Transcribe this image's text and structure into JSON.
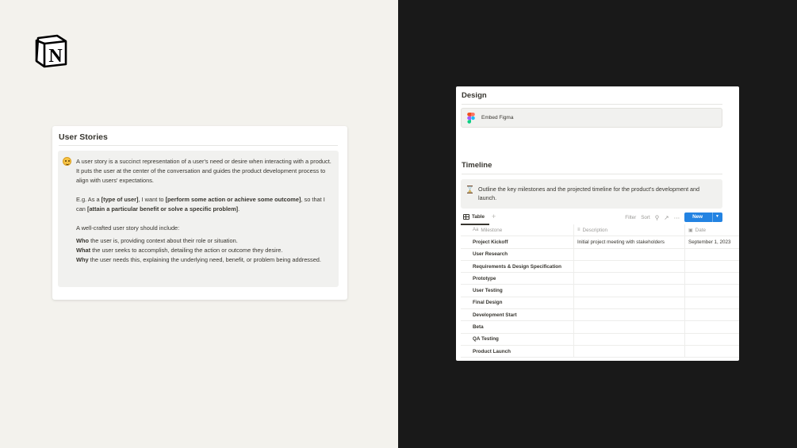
{
  "logo": {
    "icon": "notion-logo-icon",
    "letter": "N"
  },
  "user_stories": {
    "title": "User Stories",
    "emoji": "smiling-face-icon",
    "intro": "A user story is a succinct representation of a user's need or desire when interacting with a product. It puts the user at the center of the conversation and guides the product development process to align with users' expectations.",
    "example": {
      "prefix": "E.g. As a ",
      "b1": "[type of user]",
      "mid1": ", I want to ",
      "b2": "[perform some action or achieve some outcome]",
      "mid2": ", so that I can ",
      "b3": "[attain a particular benefit or solve a specific problem]",
      "suffix": "."
    },
    "include_heading": "A well-crafted user story should include:",
    "items": [
      {
        "bold": "Who",
        "text": " the user is, providing context about their role or situation."
      },
      {
        "bold": "What",
        "text": " the user seeks to accomplish, detailing the action or outcome they desire."
      },
      {
        "bold": "Why",
        "text": " the user needs this, explaining the underlying need, benefit, or problem being addressed."
      }
    ]
  },
  "design": {
    "title": "Design",
    "embed_label": "Embed Figma",
    "embed_icon": "figma-icon",
    "timeline_title": "Timeline",
    "timeline_icon": "hourglass-icon",
    "timeline_text": "Outline the key milestones and the projected timeline for the product's development and launch.",
    "toolbar": {
      "view_label": "Table",
      "add_view": "+",
      "filter": "Filter",
      "sort": "Sort",
      "new_label": "New"
    },
    "table": {
      "headers": {
        "milestone": "Milestone",
        "milestone_icon": "Aa",
        "description": "Description",
        "date": "Date"
      },
      "rows": [
        {
          "milestone": "Project Kickoff",
          "description": "Initial project meeting with stakeholders",
          "date": "September 1, 2023"
        },
        {
          "milestone": "User Research",
          "description": "",
          "date": ""
        },
        {
          "milestone": "Requirements & Design Specification",
          "description": "",
          "date": ""
        },
        {
          "milestone": "Prototype",
          "description": "",
          "date": ""
        },
        {
          "milestone": "User Testing",
          "description": "",
          "date": ""
        },
        {
          "milestone": "Final Design",
          "description": "",
          "date": ""
        },
        {
          "milestone": "Development Start",
          "description": "",
          "date": ""
        },
        {
          "milestone": "Beta",
          "description": "",
          "date": ""
        },
        {
          "milestone": "QA Testing",
          "description": "",
          "date": ""
        },
        {
          "milestone": "Product Launch",
          "description": "",
          "date": ""
        }
      ]
    }
  },
  "colors": {
    "left_bg": "#f3f2ed",
    "right_bg": "#191919",
    "accent": "#2383e2",
    "callout_bg": "#f1f1ef"
  }
}
